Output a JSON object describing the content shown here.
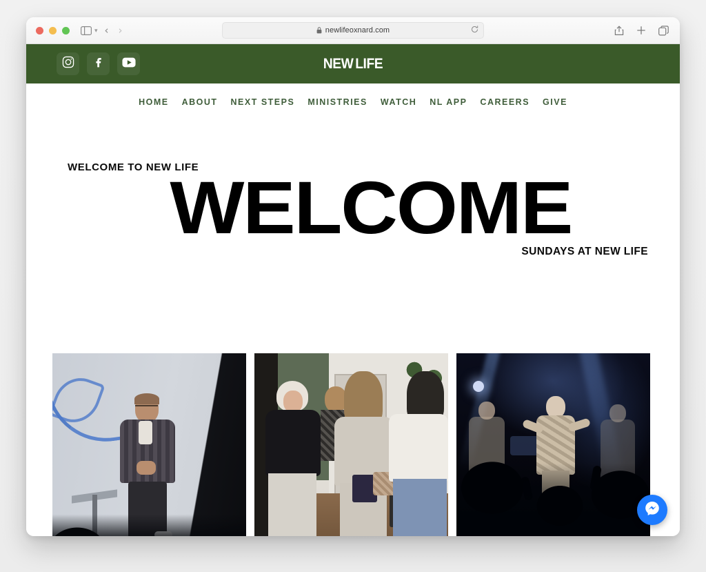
{
  "browser": {
    "url": "newlifeoxnard.com",
    "lock_icon": "lock-icon",
    "reload_icon": "reload-icon",
    "sidebar_icon": "sidebar-toggle-icon",
    "back_label": "‹",
    "forward_label": "›",
    "privacy_icon": "privacy-shield-icon",
    "share_icon": "share-icon",
    "new_tab_label": "+",
    "tabs_icon": "tab-overview-icon"
  },
  "site": {
    "brand": "NEW LIFE",
    "brand_first": "NEW",
    "brand_second": "LIFE",
    "header_color": "#3a5a29",
    "nav_color": "#3f5d3a",
    "socials": [
      {
        "name": "instagram",
        "label": "Instagram"
      },
      {
        "name": "facebook",
        "label": "Facebook"
      },
      {
        "name": "youtube",
        "label": "YouTube"
      }
    ],
    "nav": [
      {
        "label": "HOME"
      },
      {
        "label": "ABOUT"
      },
      {
        "label": "NEXT STEPS"
      },
      {
        "label": "MINISTRIES"
      },
      {
        "label": "WATCH"
      },
      {
        "label": "NL APP"
      },
      {
        "label": "CAREERS"
      },
      {
        "label": "GIVE"
      }
    ],
    "hero": {
      "kicker": "WELCOME TO NEW LIFE",
      "title": "WELCOME",
      "subtitle": "SUNDAYS AT NEW LIFE"
    },
    "gallery": [
      {
        "name": "photo-speaker-on-stage",
        "alt": "Speaker teaching on stage at a podium"
      },
      {
        "name": "photo-lobby-greeting",
        "alt": "Women greeting one another in the church lobby"
      },
      {
        "name": "photo-worship-night",
        "alt": "Worship service with band and raised hands"
      }
    ],
    "chat_widget": {
      "name": "messenger-chat-button",
      "label": "Messenger"
    }
  }
}
